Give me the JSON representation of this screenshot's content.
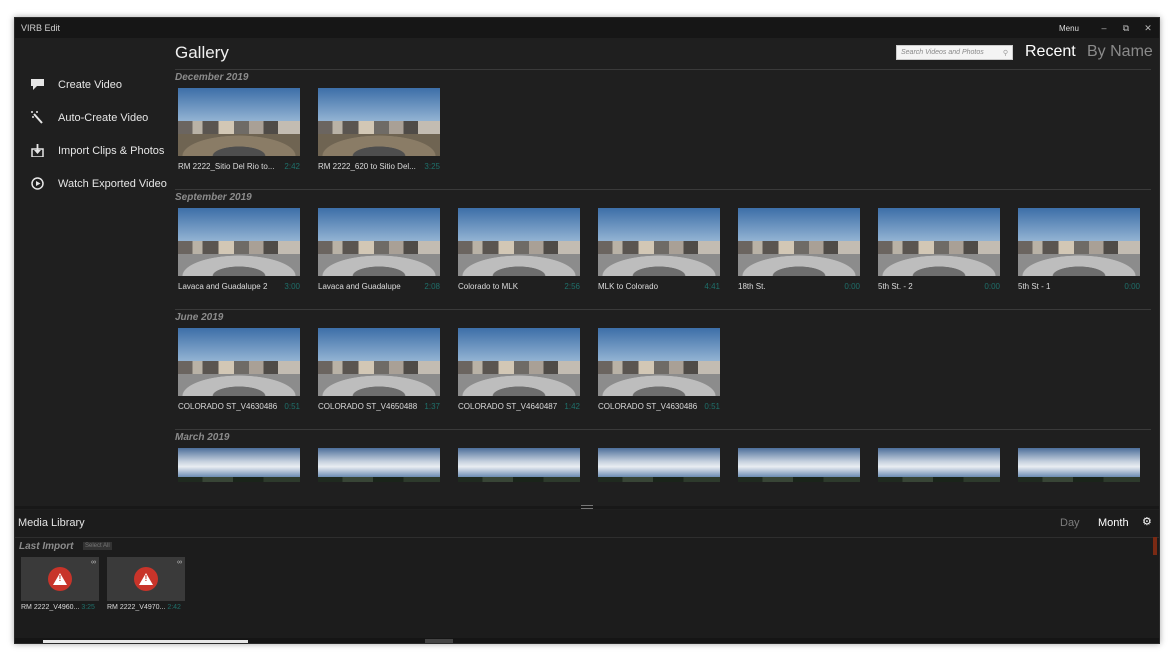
{
  "window": {
    "title": "VIRB Edit",
    "menu_label": "Menu",
    "minimize_icon": "minimize-icon",
    "restore_icon": "restore-icon",
    "close_icon": "close-icon"
  },
  "sidebar": {
    "items": [
      {
        "label": "Create Video",
        "icon": "video-chat-icon"
      },
      {
        "label": "Auto-Create Video",
        "icon": "magic-wand-icon"
      },
      {
        "label": "Import Clips & Photos",
        "icon": "import-icon"
      },
      {
        "label": "Watch Exported Video",
        "icon": "play-circle-icon"
      }
    ]
  },
  "gallery": {
    "title": "Gallery",
    "search_placeholder": "Search Videos and Photos",
    "sort_recent": "Recent",
    "sort_by_name": "By Name",
    "sections": [
      {
        "label": "December 2019",
        "items": [
          {
            "name": "RM 2222_Sitio Del Rio to...",
            "duration": "2:42"
          },
          {
            "name": "RM 2222_620 to Sitio Del...",
            "duration": "3:25"
          }
        ]
      },
      {
        "label": "September 2019",
        "items": [
          {
            "name": "Lavaca and Guadalupe 2",
            "duration": "3:00"
          },
          {
            "name": "Lavaca and Guadalupe",
            "duration": "2:08"
          },
          {
            "name": "Colorado to MLK",
            "duration": "2:56"
          },
          {
            "name": "MLK to Colorado",
            "duration": "4:41"
          },
          {
            "name": "18th St.",
            "duration": "0:00"
          },
          {
            "name": "5th St. - 2",
            "duration": "0:00"
          },
          {
            "name": "5th St - 1",
            "duration": "0:00"
          }
        ]
      },
      {
        "label": "June 2019",
        "items": [
          {
            "name": "COLORADO ST_V4630486",
            "duration": "0:51"
          },
          {
            "name": "COLORADO ST_V4650488",
            "duration": "1:37"
          },
          {
            "name": "COLORADO ST_V4640487",
            "duration": "1:42"
          },
          {
            "name": "COLORADO ST_V4630486",
            "duration": "0:51"
          }
        ]
      },
      {
        "label": "March 2019",
        "items": [
          {
            "name": "",
            "duration": ""
          },
          {
            "name": "",
            "duration": ""
          },
          {
            "name": "",
            "duration": ""
          },
          {
            "name": "",
            "duration": ""
          },
          {
            "name": "",
            "duration": ""
          },
          {
            "name": "",
            "duration": ""
          },
          {
            "name": "",
            "duration": ""
          }
        ]
      }
    ]
  },
  "media_library": {
    "title": "Media Library",
    "view_day": "Day",
    "view_month": "Month",
    "settings_icon": "gear-icon",
    "last_import_label": "Last Import",
    "select_all_label": "Select All",
    "items": [
      {
        "name": "RM 2222_V4960...",
        "duration": "3:25"
      },
      {
        "name": "RM 2222_V4970...",
        "duration": "2:42"
      }
    ]
  },
  "colors": {
    "accent": "#7a2a14",
    "duration_text": "#1f6f6a",
    "warning": "#c8342a"
  }
}
